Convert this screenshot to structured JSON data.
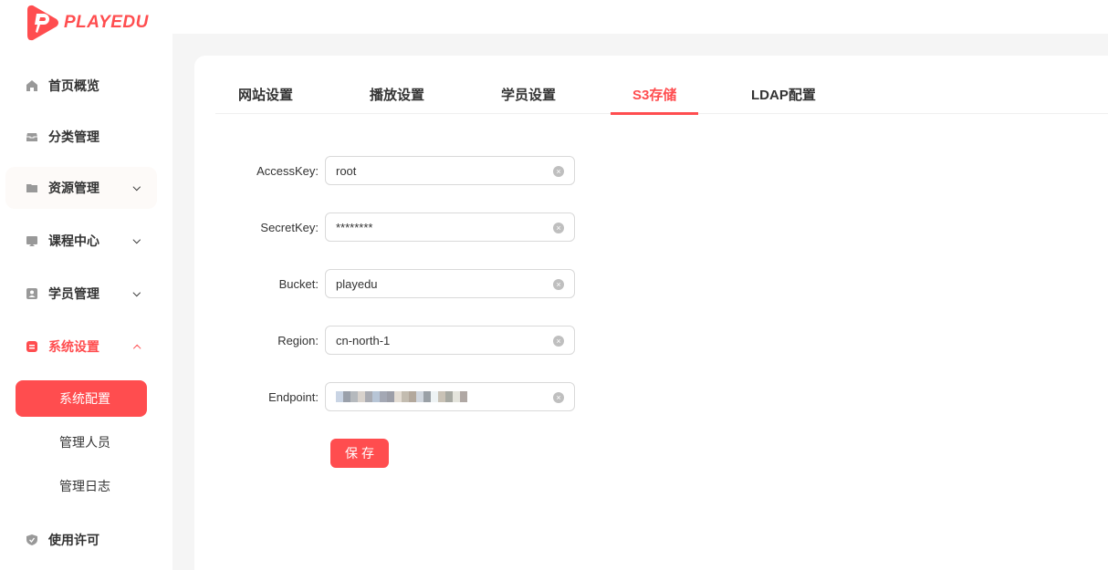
{
  "brand": {
    "name": "PLAYEDU",
    "accent": "#ff4d4f"
  },
  "sidebar": {
    "items": [
      {
        "label": "首页概览",
        "icon": "home-icon"
      },
      {
        "label": "分类管理",
        "icon": "inbox-icon"
      },
      {
        "label": "资源管理",
        "icon": "folder-icon",
        "chevron": "down"
      },
      {
        "label": "课程中心",
        "icon": "monitor-icon",
        "chevron": "down"
      },
      {
        "label": "学员管理",
        "icon": "user-card-icon",
        "chevron": "down"
      },
      {
        "label": "系统设置",
        "icon": "settings-icon",
        "chevron": "up"
      },
      {
        "label": "使用许可",
        "icon": "shield-icon"
      }
    ],
    "sub_items": [
      {
        "label": "系统配置"
      },
      {
        "label": "管理人员"
      },
      {
        "label": "管理日志"
      }
    ]
  },
  "tabs": [
    {
      "label": "网站设置"
    },
    {
      "label": "播放设置"
    },
    {
      "label": "学员设置"
    },
    {
      "label": "S3存储"
    },
    {
      "label": "LDAP配置"
    }
  ],
  "form": {
    "fields": [
      {
        "label": "AccessKey:",
        "value": "root"
      },
      {
        "label": "SecretKey:",
        "value": "********"
      },
      {
        "label": "Bucket:",
        "value": "playedu"
      },
      {
        "label": "Region:",
        "value": "cn-north-1"
      },
      {
        "label": "Endpoint:",
        "value": ""
      }
    ],
    "save_label": "保存"
  }
}
